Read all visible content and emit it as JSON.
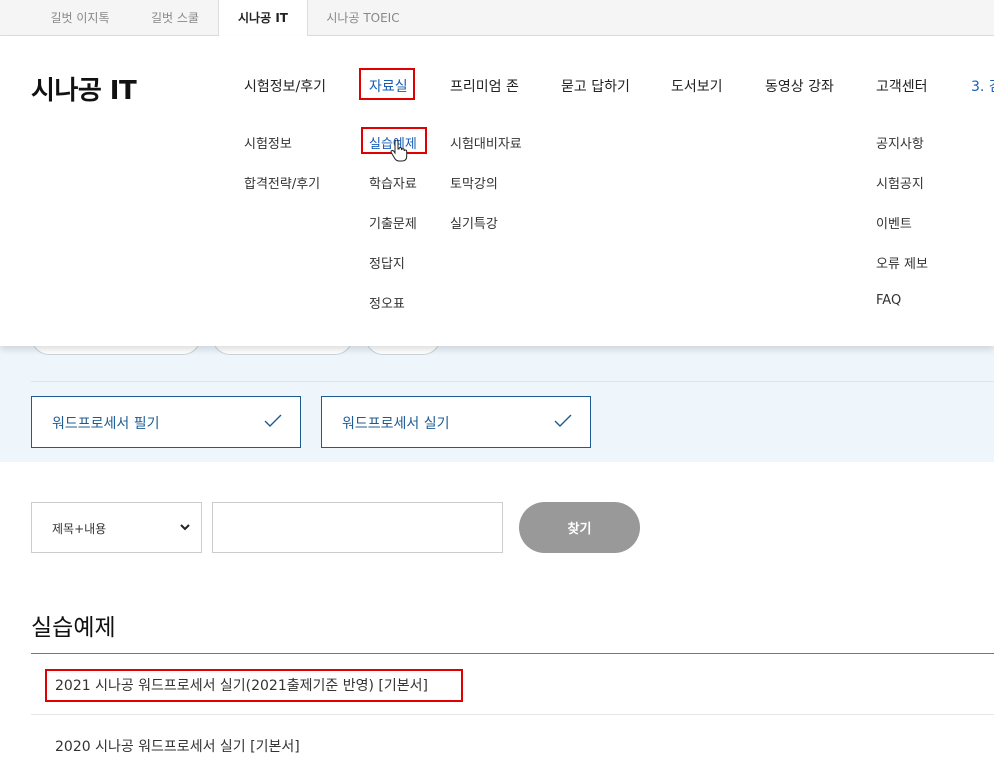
{
  "site_tabs": [
    "길벗 이지톡",
    "길벗 스쿨",
    "시나공 IT",
    "시나공 TOEIC"
  ],
  "logo": "시나공 IT",
  "nav": [
    "시험정보/후기",
    "자료실",
    "프리미엄 존",
    "묻고 답하기",
    "도서보기",
    "동영상 강좌",
    "고객센터",
    "3. 검"
  ],
  "submenu": {
    "exam_info": [
      "시험정보",
      "합격전략/후기"
    ],
    "archive_col1": [
      "실습예제",
      "학습자료",
      "기출문제",
      "정답지",
      "정오표"
    ],
    "archive_col2": [
      "시험대비자료",
      "토막강의",
      "실기특강"
    ],
    "support": [
      "공지사항",
      "시험공지",
      "이벤트",
      "오류 제보",
      "FAQ"
    ]
  },
  "categories": [
    "워드프로세서 필기",
    "워드프로세서 실기"
  ],
  "search": {
    "select_value": "제목+내용",
    "input_value": "",
    "button_label": "찾기"
  },
  "section_title": "실습예제",
  "list_items": [
    "2021 시나공 워드프로세서 실기(2021출제기준 반영) [기본서]",
    "2020 시나공 워드프로세서 실기 [기본서]"
  ],
  "colors": {
    "accent": "#1a5fb4",
    "highlight": "#e00000",
    "band": "#eef6fc",
    "button_gray": "#999999"
  }
}
